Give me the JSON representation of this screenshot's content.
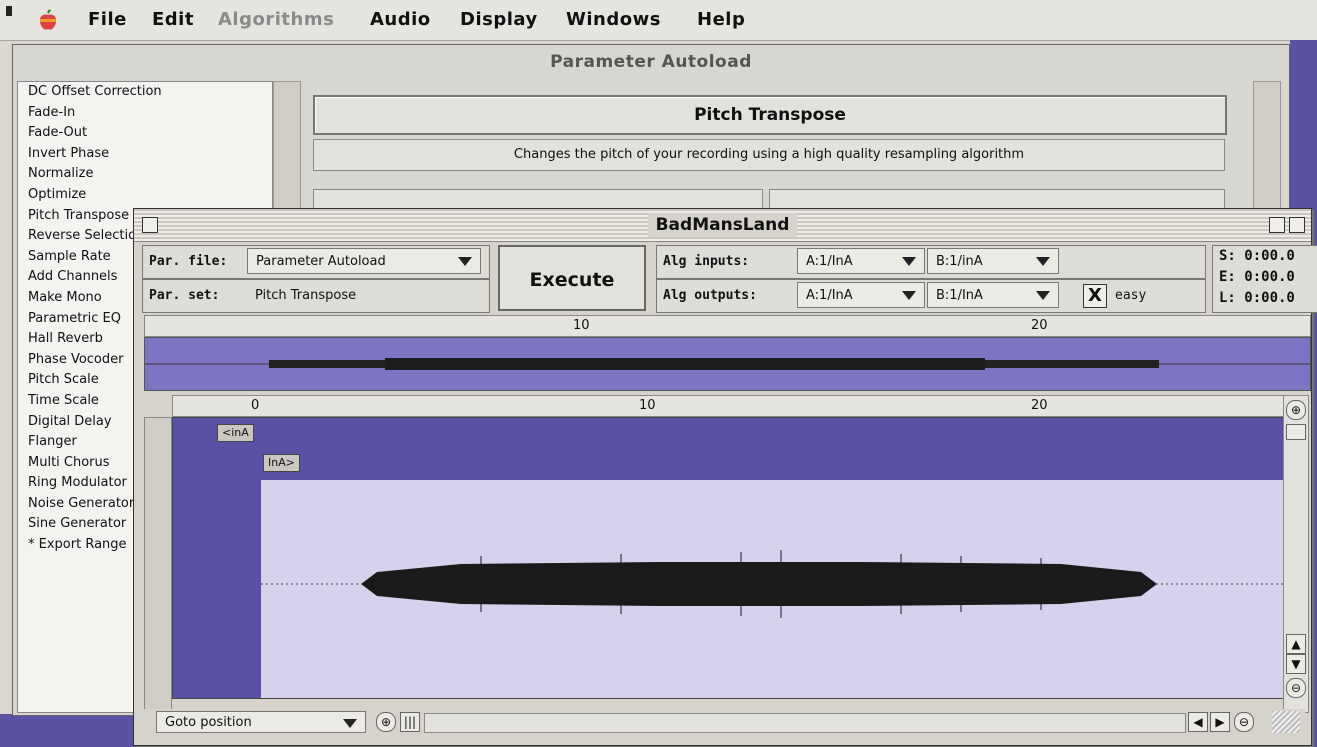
{
  "menubar": {
    "items": [
      {
        "label": "File",
        "enabled": true
      },
      {
        "label": "Edit",
        "enabled": true
      },
      {
        "label": "Algorithms",
        "enabled": false
      },
      {
        "label": "Audio",
        "enabled": true
      },
      {
        "label": "Display",
        "enabled": true
      },
      {
        "label": "Windows",
        "enabled": true
      },
      {
        "label": "Help",
        "enabled": true
      }
    ]
  },
  "background_window": {
    "title": "Parameter Autoload",
    "algorithms": [
      "DC Offset Correction",
      "Fade-In",
      "Fade-Out",
      "Invert Phase",
      "Normalize",
      "Optimize",
      "Pitch Transpose",
      "Reverse Selection",
      "Sample Rate",
      "Add Channels",
      "Make Mono",
      "Parametric EQ",
      "Hall Reverb",
      "Phase Vocoder",
      "Pitch Scale",
      "Time Scale",
      "Digital Delay",
      "Flanger",
      "Multi Chorus",
      "Ring Modulator",
      "Noise Generator",
      "Sine Generator",
      "* Export Range"
    ],
    "algorithm_title": "Pitch Transpose",
    "algorithm_description": "Changes the pitch of your recording using a high quality resampling algorithm"
  },
  "document_window": {
    "title": "BadMansLand",
    "par_file_label": "Par. file:",
    "par_file_value": "Parameter Autoload",
    "par_set_label": "Par. set:",
    "par_set_value": "Pitch Transpose",
    "execute_label": "Execute",
    "alg_inputs_label": "Alg inputs:",
    "alg_outputs_label": "Alg outputs:",
    "input_a": "A:1/InA",
    "input_b": "B:1/inA",
    "output_a": "A:1/InA",
    "output_b": "B:1/InA",
    "easy_label": "easy",
    "easy_checked": true,
    "easy_mark": "X",
    "sel_start": "S: 0:00.0",
    "sel_end": "E: 0:00.0",
    "sel_length": "L: 0:00.0",
    "overview_ticks": [
      "10",
      "20"
    ],
    "main_ticks": [
      "0",
      "10",
      "20"
    ],
    "track_chip_a": "<inA",
    "track_chip_b": "InA>",
    "goto_label": "Goto position",
    "zoom_in_glyph": "⊕",
    "zoom_out_glyph": "⊖"
  }
}
